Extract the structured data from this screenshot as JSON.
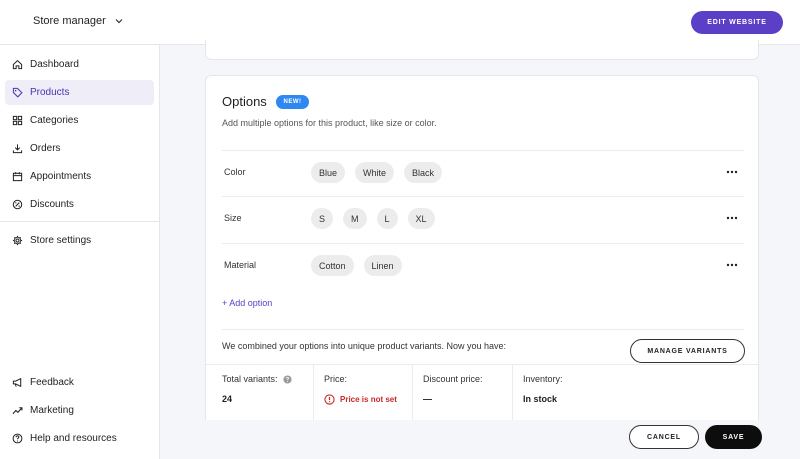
{
  "header": {
    "store_name": "Store manager",
    "edit_website_label": "EDIT WEBSITE"
  },
  "sidebar": {
    "items": [
      {
        "label": "Dashboard",
        "icon": "home-icon",
        "active": false
      },
      {
        "label": "Products",
        "icon": "tag-icon",
        "active": true
      },
      {
        "label": "Categories",
        "icon": "grid-icon",
        "active": false
      },
      {
        "label": "Orders",
        "icon": "download-icon",
        "active": false
      },
      {
        "label": "Appointments",
        "icon": "calendar-icon",
        "active": false
      },
      {
        "label": "Discounts",
        "icon": "discount-icon",
        "active": false
      },
      {
        "label": "Store settings",
        "icon": "gear-icon",
        "active": false
      }
    ],
    "bottom_items": [
      {
        "label": "Feedback",
        "icon": "megaphone-icon"
      },
      {
        "label": "Marketing",
        "icon": "trend-icon"
      },
      {
        "label": "Help and resources",
        "icon": "help-icon"
      }
    ]
  },
  "options": {
    "title": "Options",
    "badge": "NEW!",
    "subtitle": "Add multiple options for this product, like size or color.",
    "rows": [
      {
        "name": "Color",
        "values": [
          "Blue",
          "White",
          "Black"
        ]
      },
      {
        "name": "Size",
        "values": [
          "S",
          "M",
          "L",
          "XL"
        ]
      },
      {
        "name": "Material",
        "values": [
          "Cotton",
          "Linen"
        ]
      }
    ],
    "add_option_label": "+ Add option",
    "variants_text": "We combined your options into unique product variants. Now you have:",
    "manage_variants_label": "MANAGE VARIANTS",
    "stats": {
      "total_label": "Total variants:",
      "total_value": "24",
      "price_label": "Price:",
      "price_value": "Price is not set",
      "discount_label": "Discount price:",
      "discount_value": "—",
      "inventory_label": "Inventory:",
      "inventory_value": "In stock"
    }
  },
  "footer": {
    "cancel_label": "CANCEL",
    "save_label": "SAVE"
  },
  "colors": {
    "accent": "#5b3fc6",
    "badge": "#2f88f0",
    "warning": "#c62828"
  }
}
